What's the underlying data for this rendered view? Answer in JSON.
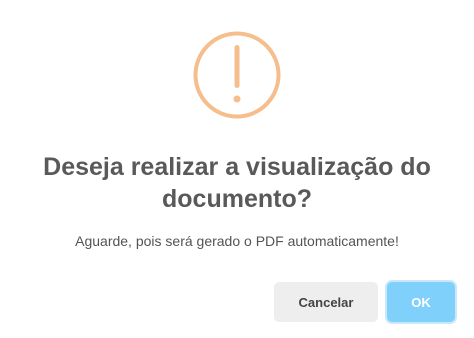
{
  "dialog": {
    "icon": "warning-exclamation-icon",
    "icon_color": "#f5be8c",
    "title": "Deseja realizar a visualização do documento?",
    "message": "Aguarde, pois será gerado o PDF automaticamente!",
    "cancel_label": "Cancelar",
    "confirm_label": "OK",
    "confirm_color": "#7fd0fb"
  }
}
